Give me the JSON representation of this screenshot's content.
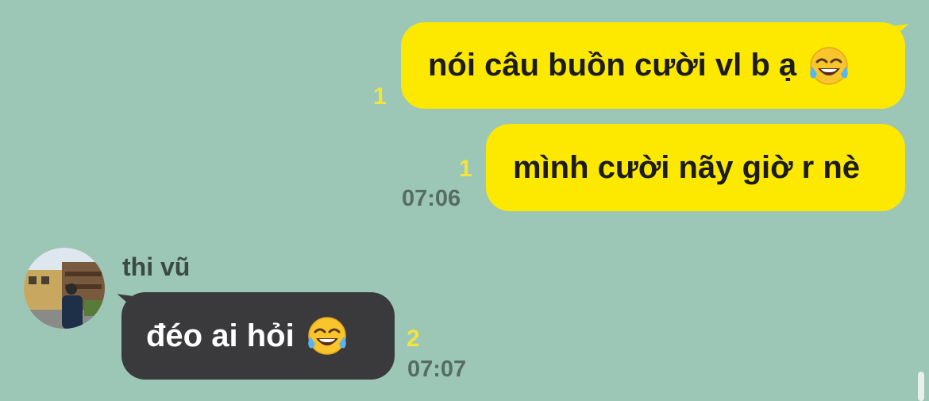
{
  "messages": {
    "out1": {
      "text": "nói câu buồn cười vl b ạ",
      "unread": "1",
      "emoji": "face-with-tears-of-joy"
    },
    "out2": {
      "text": "mình cười nãy giờ r nè",
      "unread": "1",
      "time": "07:06"
    },
    "in1": {
      "sender": "thi vũ",
      "text": "đéo ai hỏi",
      "unread": "2",
      "time": "07:07",
      "emoji": "face-with-tears-of-joy"
    }
  },
  "colors": {
    "background": "#9cc6b6",
    "outgoing_bubble": "#fde800",
    "incoming_bubble": "#3a3a3c",
    "unread_count": "#f4e43a"
  }
}
